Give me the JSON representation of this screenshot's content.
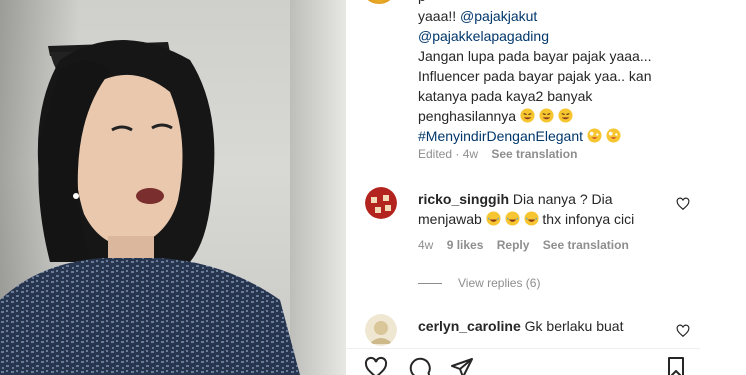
{
  "caption": {
    "line0": "p",
    "line1_text": "yaaa!! ",
    "line1_link": "@pajakjakut",
    "line2_link": "@pajakkelapagading",
    "line3": "Jangan lupa pada bayar pajak yaaa...",
    "line4": "Influencer pada bayar pajak yaa.. kan",
    "line5": "katanya pada kaya2 banyak",
    "line6": "penghasilannya",
    "line7_link": "#MenyindirDenganElegant",
    "meta_edited": "Edited · 4w",
    "meta_translation": "See translation"
  },
  "comments": [
    {
      "username": "ricko_singgih",
      "text_part1": "Dia nanya ? Dia",
      "text_part2": "menjawab",
      "text_part3": "thx infonya cici",
      "time": "4w",
      "likes": "9 likes",
      "reply": "Reply",
      "translation": "See translation",
      "view_replies": "View replies (6)"
    },
    {
      "username": "cerlyn_caroline",
      "text": "Gk berlaku buat"
    }
  ],
  "icons": {
    "like": "heart-icon",
    "comment": "comment-icon",
    "share": "send-icon",
    "save": "bookmark-icon"
  },
  "colors": {
    "link": "#00376b",
    "meta": "#8e8e8e",
    "text": "#262626"
  }
}
